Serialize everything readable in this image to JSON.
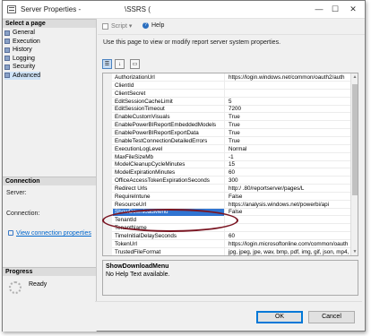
{
  "window": {
    "title": "Server Properties -",
    "server_name": "\\SSRS (",
    "close_glyph": "✕",
    "maximize_glyph": "☐",
    "minimize_glyph": "—"
  },
  "left_pane": {
    "select_page_header": "Select a page",
    "pages": [
      {
        "label": "General"
      },
      {
        "label": "Execution"
      },
      {
        "label": "History"
      },
      {
        "label": "Logging"
      },
      {
        "label": "Security"
      },
      {
        "label": "Advanced",
        "selected": true
      }
    ],
    "connection_header": "Connection",
    "server_label": "Server:",
    "connection_label": "Connection:",
    "view_connection_link": "View connection properties",
    "progress_header": "Progress",
    "progress_status": "Ready"
  },
  "toolbar": {
    "script_label": "Script",
    "script_dropdown_glyph": "▾",
    "help_label": "Help"
  },
  "info_text": "Use this page to view or modify report server system properties.",
  "sort_buttons": {
    "categorized": "☰",
    "alphabetical": "↓",
    "pages": "▭"
  },
  "grid": {
    "rows": [
      {
        "name": "AuthorizationUrl",
        "value": "https://login.windows.net/common/oauth2/auth"
      },
      {
        "name": "ClientId",
        "value": ""
      },
      {
        "name": "ClientSecret",
        "value": ""
      },
      {
        "name": "EditSessionCacheLimit",
        "value": "5"
      },
      {
        "name": "EditSessionTimeout",
        "value": "7200"
      },
      {
        "name": "EnableCustomVisuals",
        "value": "True"
      },
      {
        "name": "EnablePowerBIReportEmbeddedModels",
        "value": "True"
      },
      {
        "name": "EnablePowerBIReportExportData",
        "value": "True"
      },
      {
        "name": "EnableTestConnectionDetailedErrors",
        "value": "True"
      },
      {
        "name": "ExecutionLogLevel",
        "value": "Normal"
      },
      {
        "name": "MaxFileSizeMb",
        "value": "-1"
      },
      {
        "name": "ModelCleanupCycleMinutes",
        "value": "15"
      },
      {
        "name": "ModelExpirationMinutes",
        "value": "60"
      },
      {
        "name": "OfficeAccessTokenExpirationSeconds",
        "value": "300"
      },
      {
        "name": "Redirect Urls",
        "value": "http:/                  .80/reportserver/pages/L"
      },
      {
        "name": "RequireIntune",
        "value": "False"
      },
      {
        "name": "ResourceUrl",
        "value": "https://analysis.windows.net/powerbi/api"
      },
      {
        "name": "ShowDownloadMenu",
        "value": "False",
        "selected": true
      },
      {
        "name": "TenantId",
        "value": ""
      },
      {
        "name": "TenantName",
        "value": ""
      },
      {
        "name": "TimeInitialDelaySeconds",
        "value": "60"
      },
      {
        "name": "TokenUrl",
        "value": "https://login.microsoftonline.com/common/oauth"
      },
      {
        "name": "TrustedFileFormat",
        "value": "jpg, jpeg, jpe, wav, bmp, pdf, img, gif, json, mp4, w"
      }
    ]
  },
  "description": {
    "title": "ShowDownloadMenu",
    "text": "No Help Text available."
  },
  "buttons": {
    "ok": "OK",
    "cancel": "Cancel"
  },
  "colors": {
    "selection": "#3074d1",
    "annotation_ellipse": "#7a1522",
    "link": "#0066cc"
  }
}
